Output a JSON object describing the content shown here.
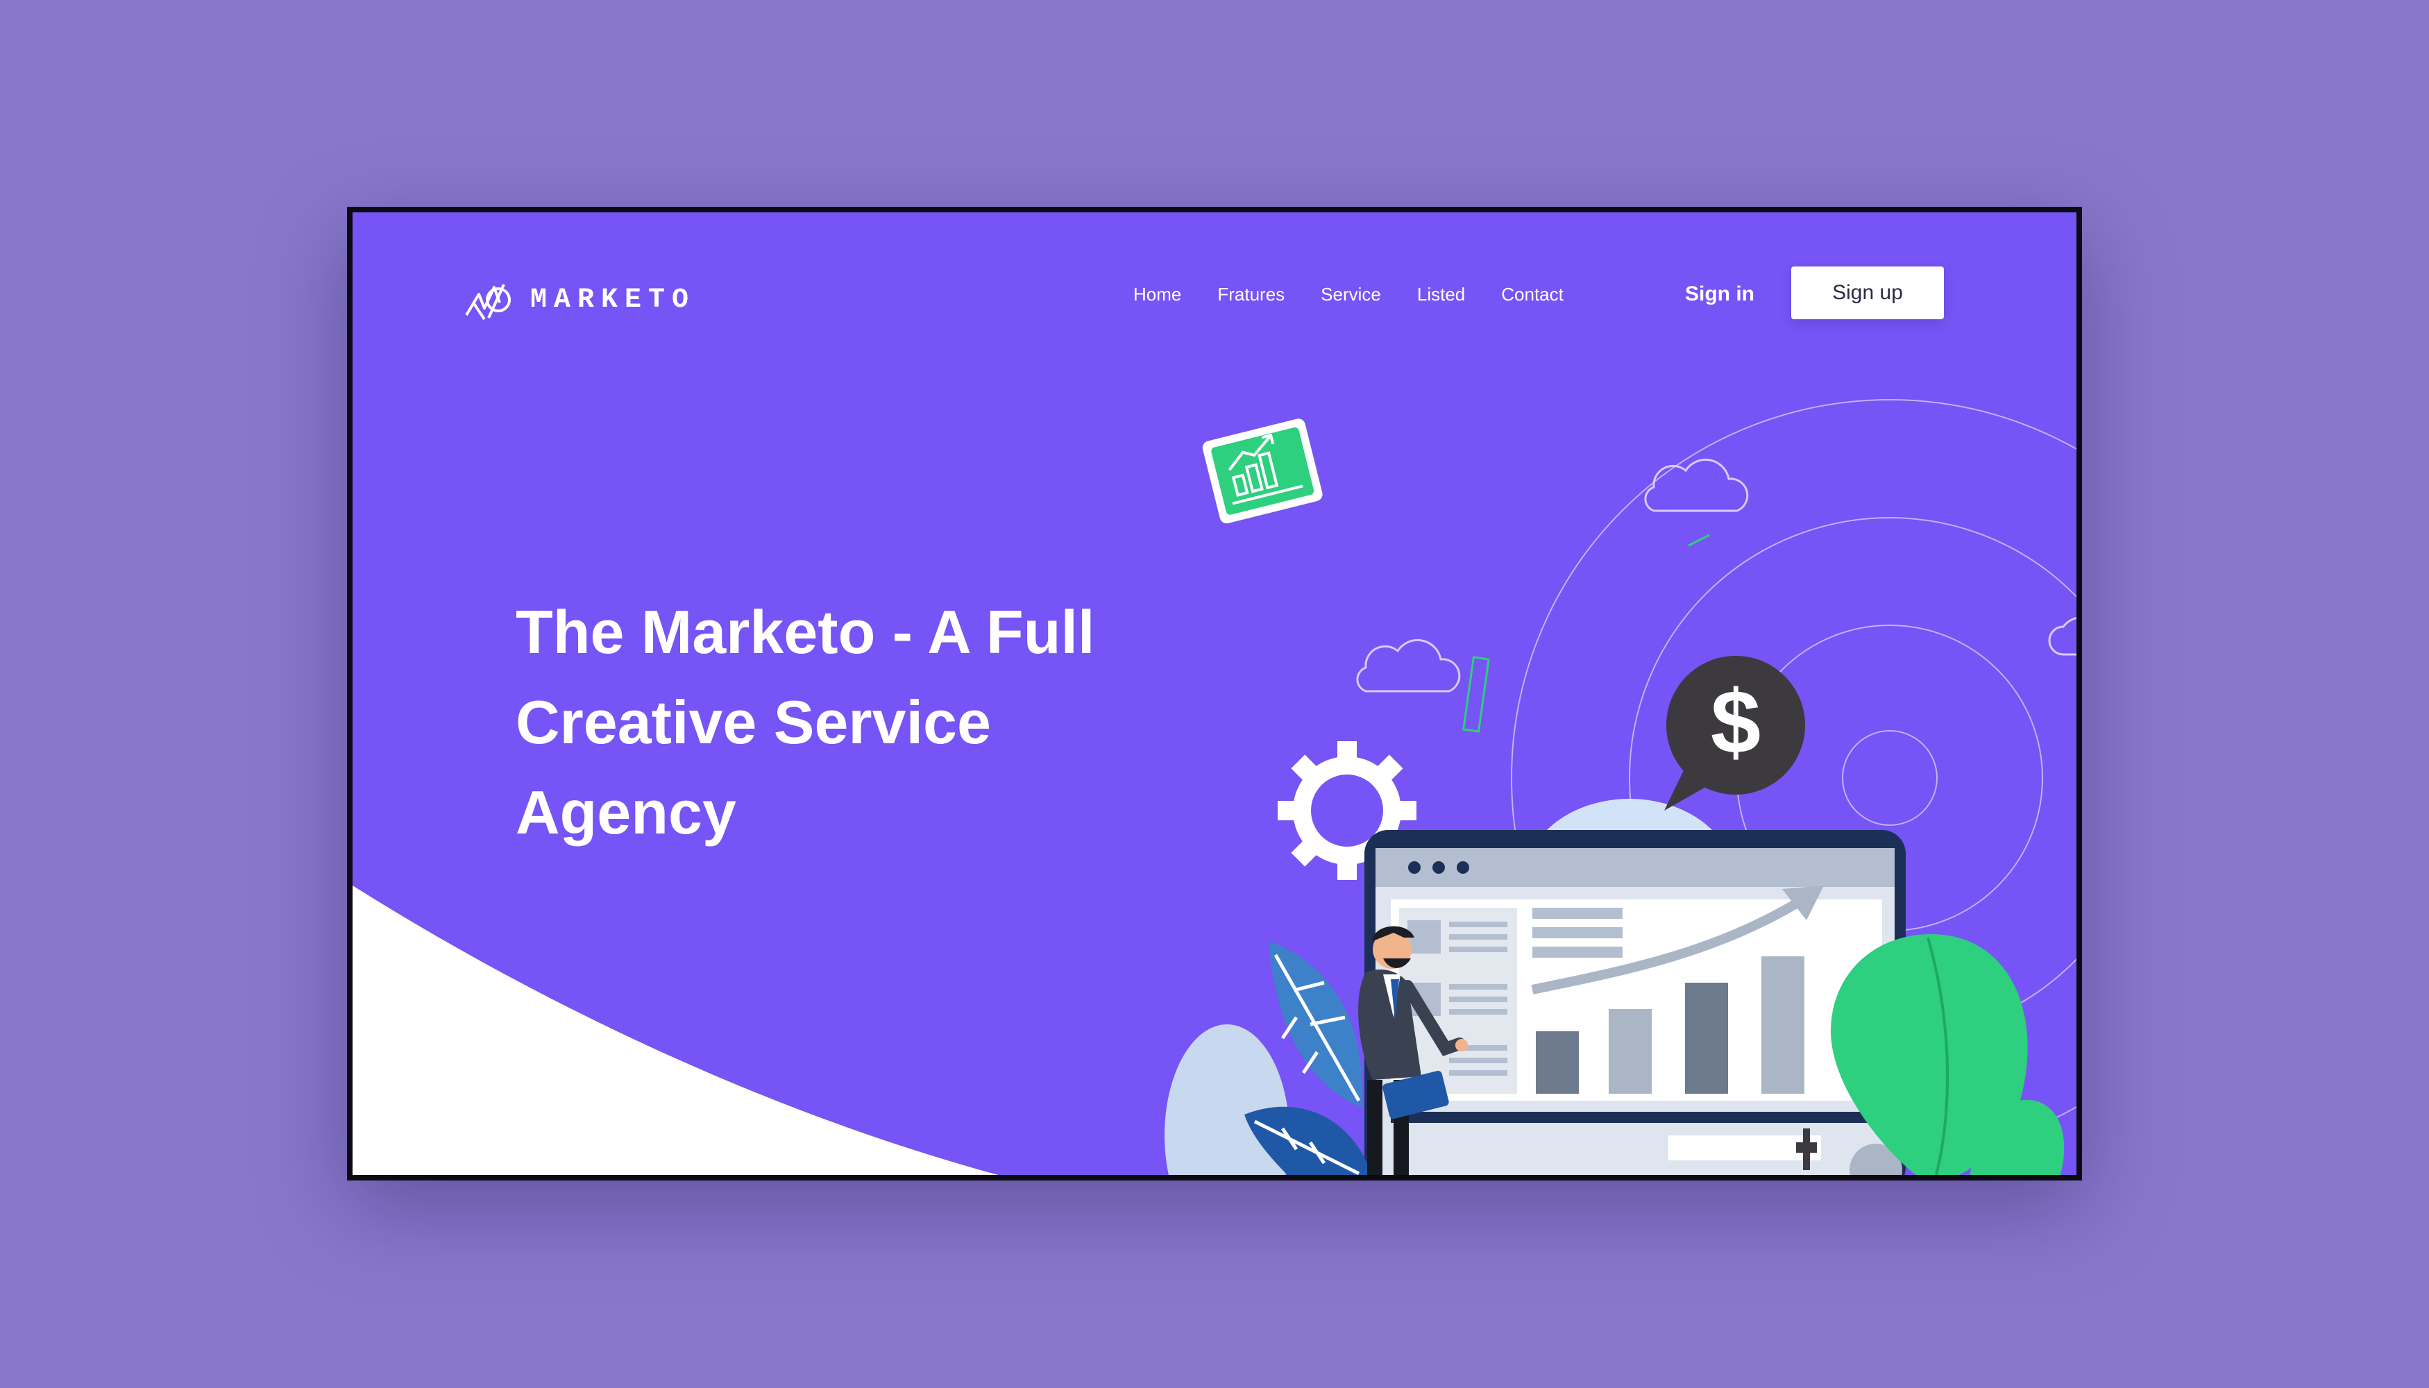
{
  "brand": {
    "name": "MARKETO"
  },
  "nav": {
    "items": [
      "Home",
      "Fratures",
      "Service",
      "Listed",
      "Contact"
    ]
  },
  "auth": {
    "sign_in_label": "Sign in",
    "sign_up_label": "Sign up"
  },
  "hero": {
    "title": "The Marketo - A Full Creative Service Agency"
  },
  "illustration": {
    "dollar_symbol": "$",
    "icons": [
      "chart-card-icon",
      "gear-icon",
      "dollar-bubble-icon",
      "cloud-icon",
      "browser-dashboard",
      "businessman-figure",
      "leaf-icon"
    ]
  },
  "colors": {
    "page_background": "#8878cc",
    "brand_purple": "#7654f5",
    "accent_green": "#2ecf7e",
    "dark_navy": "#1c2f57",
    "bubble_dark": "#3c3a3e"
  }
}
